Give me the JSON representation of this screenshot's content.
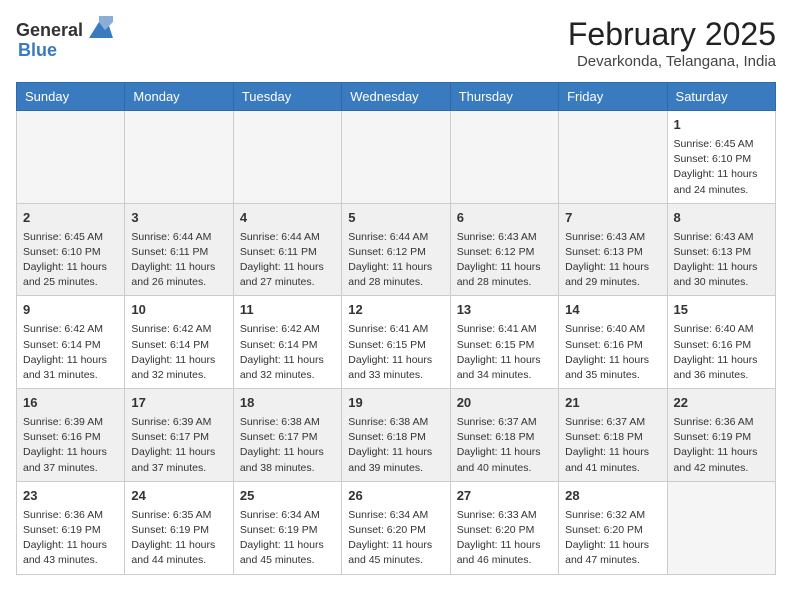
{
  "header": {
    "logo_general": "General",
    "logo_blue": "Blue",
    "month": "February 2025",
    "location": "Devarkonda, Telangana, India"
  },
  "weekdays": [
    "Sunday",
    "Monday",
    "Tuesday",
    "Wednesday",
    "Thursday",
    "Friday",
    "Saturday"
  ],
  "weeks": [
    [
      {
        "day": "",
        "info": ""
      },
      {
        "day": "",
        "info": ""
      },
      {
        "day": "",
        "info": ""
      },
      {
        "day": "",
        "info": ""
      },
      {
        "day": "",
        "info": ""
      },
      {
        "day": "",
        "info": ""
      },
      {
        "day": "1",
        "info": "Sunrise: 6:45 AM\nSunset: 6:10 PM\nDaylight: 11 hours\nand 24 minutes."
      }
    ],
    [
      {
        "day": "2",
        "info": "Sunrise: 6:45 AM\nSunset: 6:10 PM\nDaylight: 11 hours\nand 25 minutes."
      },
      {
        "day": "3",
        "info": "Sunrise: 6:44 AM\nSunset: 6:11 PM\nDaylight: 11 hours\nand 26 minutes."
      },
      {
        "day": "4",
        "info": "Sunrise: 6:44 AM\nSunset: 6:11 PM\nDaylight: 11 hours\nand 27 minutes."
      },
      {
        "day": "5",
        "info": "Sunrise: 6:44 AM\nSunset: 6:12 PM\nDaylight: 11 hours\nand 28 minutes."
      },
      {
        "day": "6",
        "info": "Sunrise: 6:43 AM\nSunset: 6:12 PM\nDaylight: 11 hours\nand 28 minutes."
      },
      {
        "day": "7",
        "info": "Sunrise: 6:43 AM\nSunset: 6:13 PM\nDaylight: 11 hours\nand 29 minutes."
      },
      {
        "day": "8",
        "info": "Sunrise: 6:43 AM\nSunset: 6:13 PM\nDaylight: 11 hours\nand 30 minutes."
      }
    ],
    [
      {
        "day": "9",
        "info": "Sunrise: 6:42 AM\nSunset: 6:14 PM\nDaylight: 11 hours\nand 31 minutes."
      },
      {
        "day": "10",
        "info": "Sunrise: 6:42 AM\nSunset: 6:14 PM\nDaylight: 11 hours\nand 32 minutes."
      },
      {
        "day": "11",
        "info": "Sunrise: 6:42 AM\nSunset: 6:14 PM\nDaylight: 11 hours\nand 32 minutes."
      },
      {
        "day": "12",
        "info": "Sunrise: 6:41 AM\nSunset: 6:15 PM\nDaylight: 11 hours\nand 33 minutes."
      },
      {
        "day": "13",
        "info": "Sunrise: 6:41 AM\nSunset: 6:15 PM\nDaylight: 11 hours\nand 34 minutes."
      },
      {
        "day": "14",
        "info": "Sunrise: 6:40 AM\nSunset: 6:16 PM\nDaylight: 11 hours\nand 35 minutes."
      },
      {
        "day": "15",
        "info": "Sunrise: 6:40 AM\nSunset: 6:16 PM\nDaylight: 11 hours\nand 36 minutes."
      }
    ],
    [
      {
        "day": "16",
        "info": "Sunrise: 6:39 AM\nSunset: 6:16 PM\nDaylight: 11 hours\nand 37 minutes."
      },
      {
        "day": "17",
        "info": "Sunrise: 6:39 AM\nSunset: 6:17 PM\nDaylight: 11 hours\nand 37 minutes."
      },
      {
        "day": "18",
        "info": "Sunrise: 6:38 AM\nSunset: 6:17 PM\nDaylight: 11 hours\nand 38 minutes."
      },
      {
        "day": "19",
        "info": "Sunrise: 6:38 AM\nSunset: 6:18 PM\nDaylight: 11 hours\nand 39 minutes."
      },
      {
        "day": "20",
        "info": "Sunrise: 6:37 AM\nSunset: 6:18 PM\nDaylight: 11 hours\nand 40 minutes."
      },
      {
        "day": "21",
        "info": "Sunrise: 6:37 AM\nSunset: 6:18 PM\nDaylight: 11 hours\nand 41 minutes."
      },
      {
        "day": "22",
        "info": "Sunrise: 6:36 AM\nSunset: 6:19 PM\nDaylight: 11 hours\nand 42 minutes."
      }
    ],
    [
      {
        "day": "23",
        "info": "Sunrise: 6:36 AM\nSunset: 6:19 PM\nDaylight: 11 hours\nand 43 minutes."
      },
      {
        "day": "24",
        "info": "Sunrise: 6:35 AM\nSunset: 6:19 PM\nDaylight: 11 hours\nand 44 minutes."
      },
      {
        "day": "25",
        "info": "Sunrise: 6:34 AM\nSunset: 6:19 PM\nDaylight: 11 hours\nand 45 minutes."
      },
      {
        "day": "26",
        "info": "Sunrise: 6:34 AM\nSunset: 6:20 PM\nDaylight: 11 hours\nand 45 minutes."
      },
      {
        "day": "27",
        "info": "Sunrise: 6:33 AM\nSunset: 6:20 PM\nDaylight: 11 hours\nand 46 minutes."
      },
      {
        "day": "28",
        "info": "Sunrise: 6:32 AM\nSunset: 6:20 PM\nDaylight: 11 hours\nand 47 minutes."
      },
      {
        "day": "",
        "info": ""
      }
    ]
  ]
}
